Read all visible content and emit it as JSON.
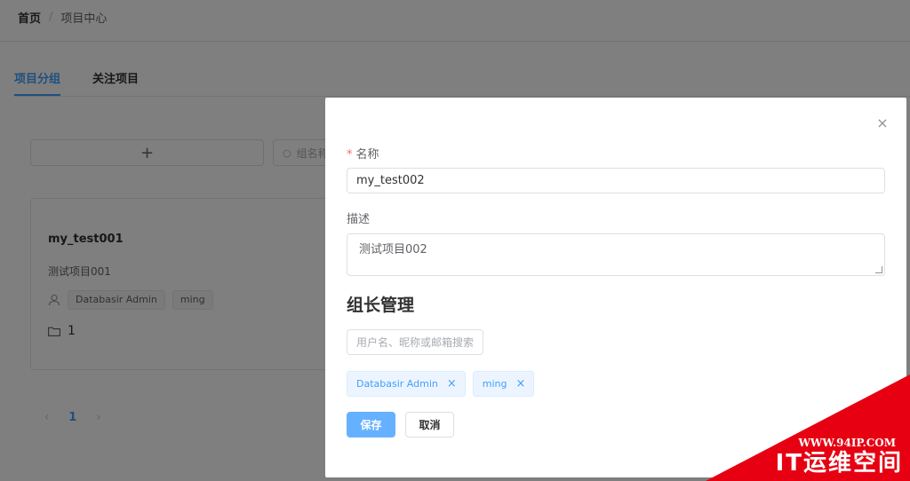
{
  "breadcrumb": {
    "home": "首页",
    "separator": "/",
    "current": "项目中心"
  },
  "tabs": [
    {
      "label": "项目分组",
      "active": true
    },
    {
      "label": "关注项目",
      "active": false
    }
  ],
  "toolbar": {
    "add_label": "+",
    "search_placeholder": "组名称"
  },
  "card": {
    "title": "my_test001",
    "description": "测试项目001",
    "owners": [
      "Databasir Admin",
      "ming"
    ],
    "project_count": "1"
  },
  "pagination": {
    "prev": "‹",
    "current": "1",
    "next": "›"
  },
  "dialog": {
    "close_icon": "×",
    "name_label": "名称",
    "required_mark": "*",
    "name_value": "my_test002",
    "desc_label": "描述",
    "desc_value": "测试项目002",
    "section_title": "组长管理",
    "user_search_placeholder": "用户名、昵称或邮箱搜索",
    "selected_users": [
      "Databasir Admin",
      "ming"
    ],
    "tag_close": "×",
    "save_label": "保存",
    "cancel_label": "取消"
  },
  "watermark": {
    "url": "WWW.94IP.COM",
    "brand": "IT运维空间"
  },
  "colors": {
    "primary": "#409eff",
    "primary_light": "#66b1ff",
    "danger": "#f56c6c",
    "watermark": "#e60012"
  }
}
